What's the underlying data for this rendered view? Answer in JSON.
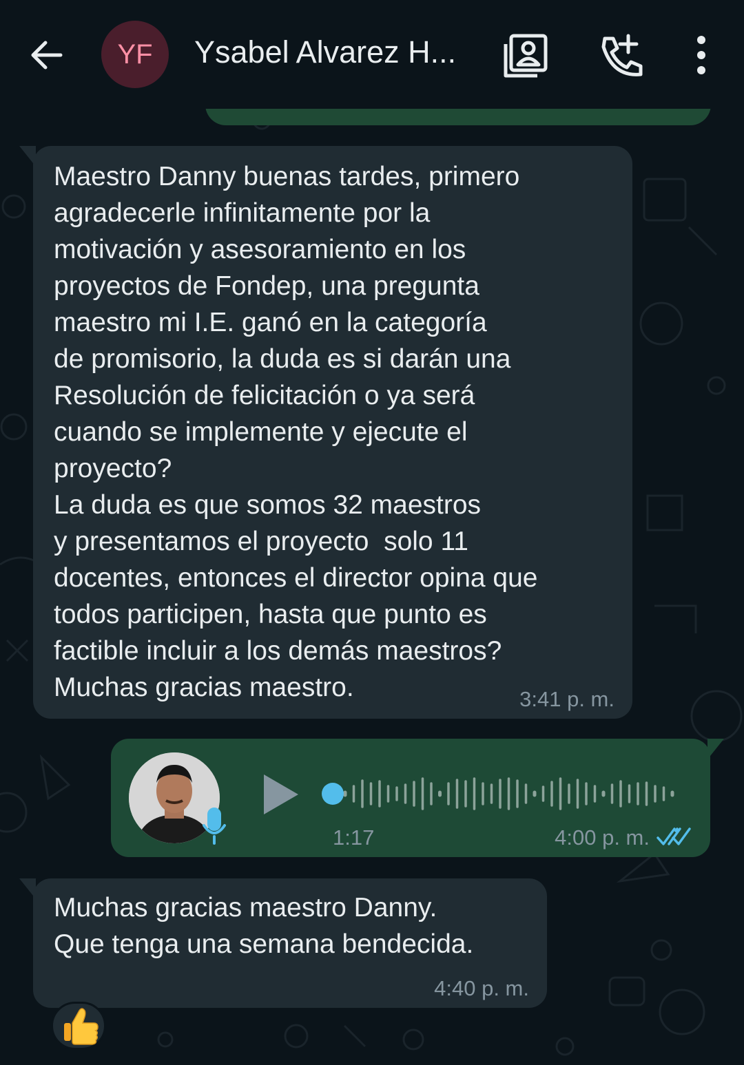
{
  "header": {
    "avatar_initials": "YF",
    "contact_name": "Ysabel Alvarez H...",
    "icons": [
      "back-arrow-icon",
      "contact-card-icon",
      "add-call-icon",
      "more-vert-icon"
    ]
  },
  "messages": [
    {
      "type": "incoming-text",
      "text": "Maestro Danny buenas tardes, primero\nagradecerle infinitamente por la\nmotivación y asesoramiento en los\nproyectos de Fondep, una pregunta\nmaestro mi I.E. ganó en la categoría\nde promisorio, la duda es si darán una\nResolución de felicitación o ya será\ncuando se implemente y ejecute el\nproyecto?\nLa duda es que somos 32 maestros\ny presentamos el proyecto  solo 11\ndocentes, entonces el director opina que\ntodos participen, hasta que punto es\nfactible incluir a los demás maestros?\nMuchas gracias maestro.",
      "time": "3:41 p. m."
    },
    {
      "type": "outgoing-voice",
      "duration": "1:17",
      "time": "4:00 p. m.",
      "status": "read",
      "playback_progress": 0
    },
    {
      "type": "incoming-text",
      "text": "Muchas gracias maestro Danny.\nQue tenga una semana bendecida.",
      "time": "4:40 p. m.",
      "reaction": "👍"
    }
  ],
  "colors": {
    "background": "#0b141a",
    "incoming_bubble": "#202c33",
    "outgoing_bubble": "#1e4a36",
    "avatar_bg": "#4a1e2c",
    "avatar_text": "#ff90a6",
    "read_ticks": "#53bdeb",
    "meta_text": "#8696a0"
  }
}
